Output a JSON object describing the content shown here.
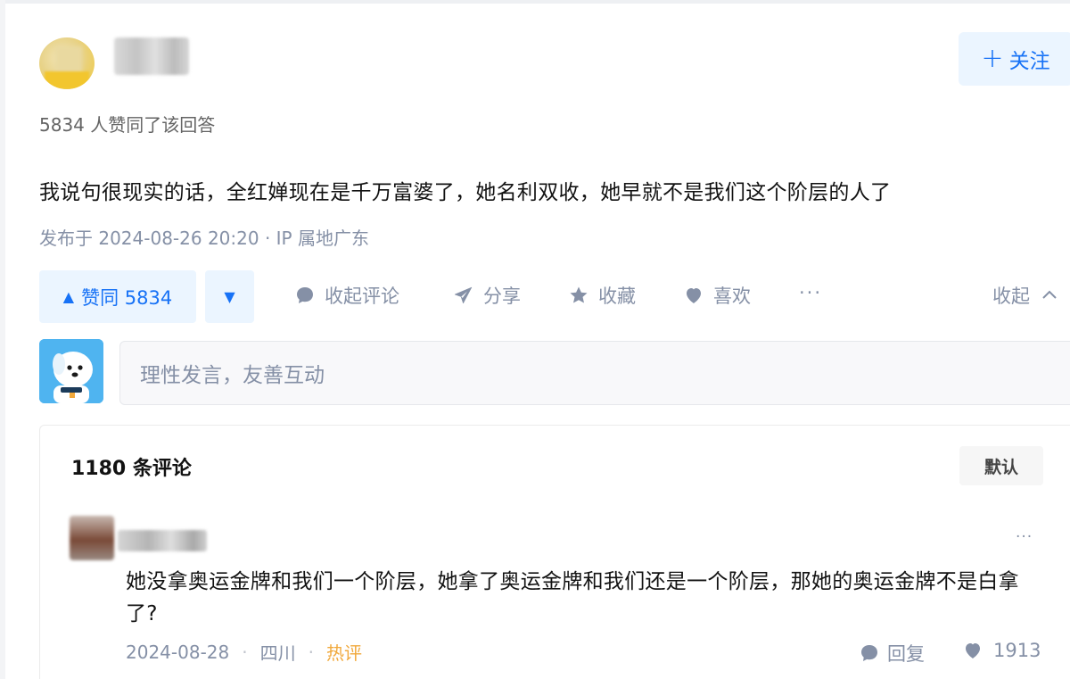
{
  "author": {
    "follow_label": "关注"
  },
  "answer": {
    "likes_meta": "5834 人赞同了该回答",
    "text": "我说句很现实的话，全红婵现在是千万富婆了，她名利双收，她早就不是我们这个阶层的人了",
    "published": "发布于 2024-08-26 20:20 · IP 属地广东"
  },
  "actions": {
    "vote_up_label": "赞同 5834",
    "vote_up_icon": "▲",
    "vote_down_icon": "▼",
    "collapse_comments": "收起评论",
    "share": "分享",
    "favorite": "收藏",
    "like": "喜欢",
    "more": "···",
    "collapse": "收起"
  },
  "comment_box": {
    "placeholder": "理性发言，友善互动"
  },
  "comments": {
    "count_label": "1180 条评论",
    "sort_label": "默认",
    "items": [
      {
        "text": "她没拿奥运金牌和我们一个阶层，她拿了奥运金牌和我们还是一个阶层，那她的奥运金牌不是白拿了?",
        "date": "2024-08-28",
        "location": "四川",
        "tag": "热评",
        "reply_label": "回复",
        "likes": "1913",
        "more": "···"
      }
    ]
  },
  "colors": {
    "accent": "#1772f6",
    "accent_bg": "#ebf5ff",
    "muted": "#8590a6",
    "hot": "#f1a93c"
  }
}
